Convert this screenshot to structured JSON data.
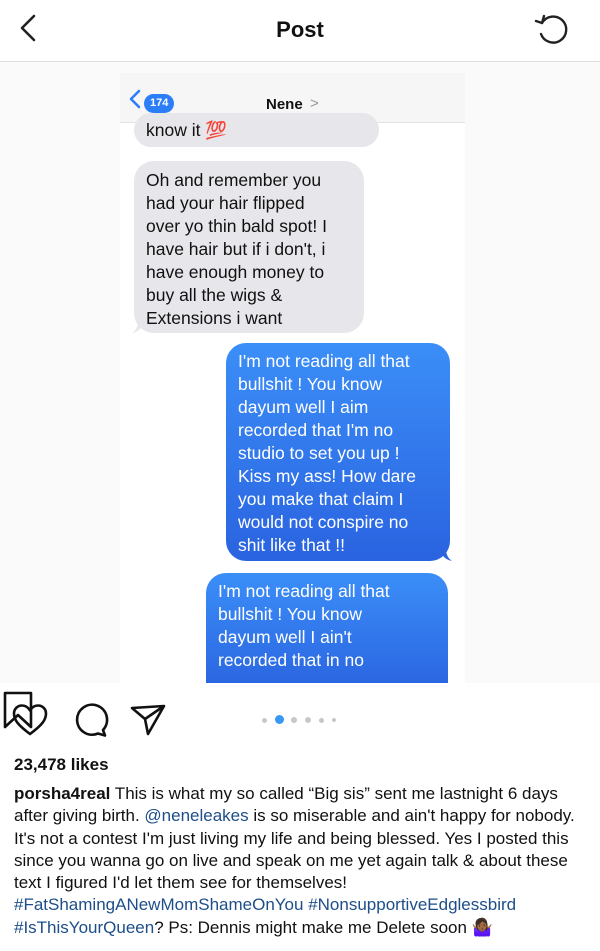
{
  "header": {
    "title": "Post"
  },
  "messages_screenshot": {
    "badge_count": "174",
    "contact_name": "Nene",
    "contact_chevron": ">",
    "bubbles": [
      {
        "side": "received",
        "lines": [
          "know it 💯"
        ]
      },
      {
        "side": "received",
        "lines": [
          "Oh and remember you",
          "had your hair flipped",
          "over yo thin bald spot! I",
          "have hair but if i don't, i",
          "have enough money to",
          "buy all the wigs &",
          "Extensions i want"
        ]
      },
      {
        "side": "sent",
        "lines": [
          "I'm not reading all that",
          "bullshit ! You know",
          "dayum well I aim",
          "recorded that I'm no",
          "studio to set you up !",
          "Kiss my ass! How dare",
          "you make that claim I",
          "would not conspire no",
          "shit like that !!"
        ]
      },
      {
        "side": "sent",
        "lines": [
          "I'm not reading all that",
          "bullshit ! You know",
          "dayum well I ain't",
          "recorded that in no"
        ]
      }
    ]
  },
  "actions": {
    "like_icon": "heart-outline-icon",
    "comment_icon": "comment-bubble-icon",
    "share_icon": "paper-plane-icon",
    "save_icon": "bookmark-icon",
    "carousel_total": 6,
    "carousel_active": 2
  },
  "likes": "23,478 likes",
  "caption": {
    "username": "porsha4real",
    "segments": [
      {
        "type": "text",
        "value": " This is what my so called “Big sis” sent me lastnight 6 days after giving birth. "
      },
      {
        "type": "tag",
        "value": "@neneleakes"
      },
      {
        "type": "text",
        "value": " is so miserable and ain't happy for nobody. It's not a contest I'm just living my life and being blessed. Yes I posted this since you wanna go on live and speak on me yet again talk & about these text I figured I'd let them see for themselves! "
      },
      {
        "type": "tag",
        "value": "#FatShamingANewMomShameOnYou"
      },
      {
        "type": "text",
        "value": " "
      },
      {
        "type": "tag",
        "value": "#NonsupportiveEdglessbird"
      },
      {
        "type": "text",
        "value": " "
      },
      {
        "type": "tag",
        "value": "#IsThisYourQueen"
      },
      {
        "type": "text",
        "value": "? Ps: Dennis might make me Delete soon 🤷🏾‍♀️"
      }
    ]
  },
  "colors": {
    "accent_blue": "#3897f0",
    "imessage_blue": "#2a73ea",
    "imessage_gray": "#e6e6eb",
    "tag_blue": "#1d4e89"
  }
}
